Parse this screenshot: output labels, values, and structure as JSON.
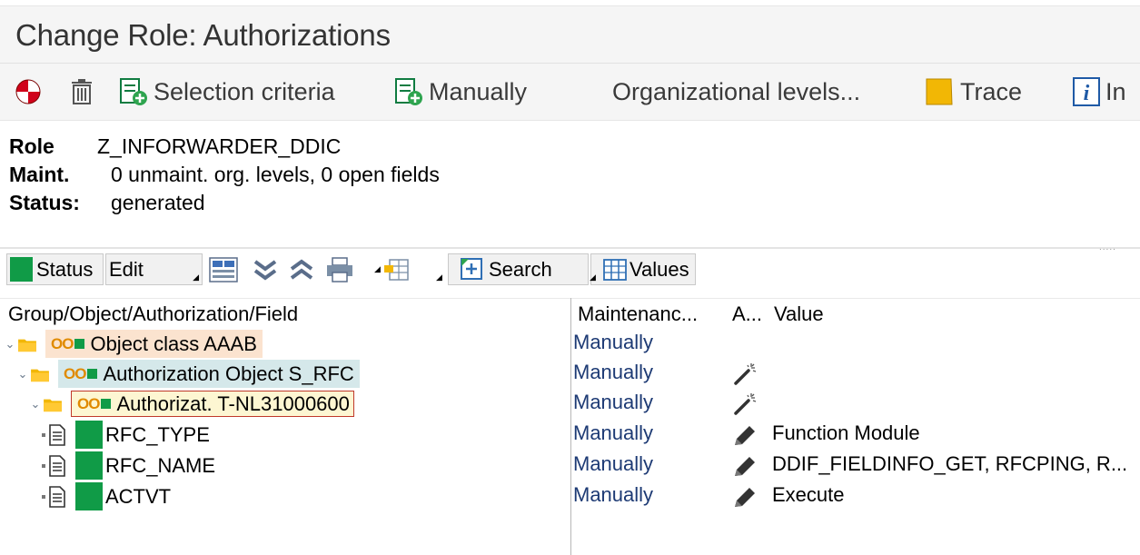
{
  "window": {
    "title": "Change Role: Authorizations"
  },
  "toolbar": {
    "selection_criteria": "Selection criteria",
    "manually": "Manually",
    "org_levels": "Organizational levels...",
    "trace": "Trace",
    "info": "In"
  },
  "role_info": {
    "role_label": "Role",
    "role_value": "Z_INFORWARDER_DDIC",
    "maint_label": "Maint.",
    "maint_value": "0 unmaint. org. levels, 0 open fields",
    "status_label": "Status:",
    "status_value": "generated"
  },
  "tree_toolbar": {
    "status": "Status",
    "edit": "Edit",
    "search": "Search",
    "values": "Values"
  },
  "columns": {
    "tree": "Group/Object/Authorization/Field",
    "maintenance": "Maintenanc...",
    "a": "A...",
    "value": "Value"
  },
  "rows": [
    {
      "label": "Object class AAAB",
      "maintenance": "Manually",
      "value": ""
    },
    {
      "label": "Authorization Object S_RFC",
      "maintenance": "Manually",
      "value": ""
    },
    {
      "label": "Authorizat. T-NL31000600",
      "maintenance": "Manually",
      "value": ""
    },
    {
      "label": "RFC_TYPE",
      "maintenance": "Manually",
      "value": "Function Module"
    },
    {
      "label": "RFC_NAME",
      "maintenance": "Manually",
      "value": "DDIF_FIELDINFO_GET, RFCPING, R..."
    },
    {
      "label": "ACTVT",
      "maintenance": "Manually",
      "value": "Execute"
    }
  ],
  "colors": {
    "status_green": "#109b47",
    "folder_yellow": "#f2b705",
    "object_class_bg": "#fbe3cf",
    "auth_object_bg": "#d5e8ea",
    "authorization_bg": "#fdf6d2",
    "authorization_border": "#c0392b"
  }
}
